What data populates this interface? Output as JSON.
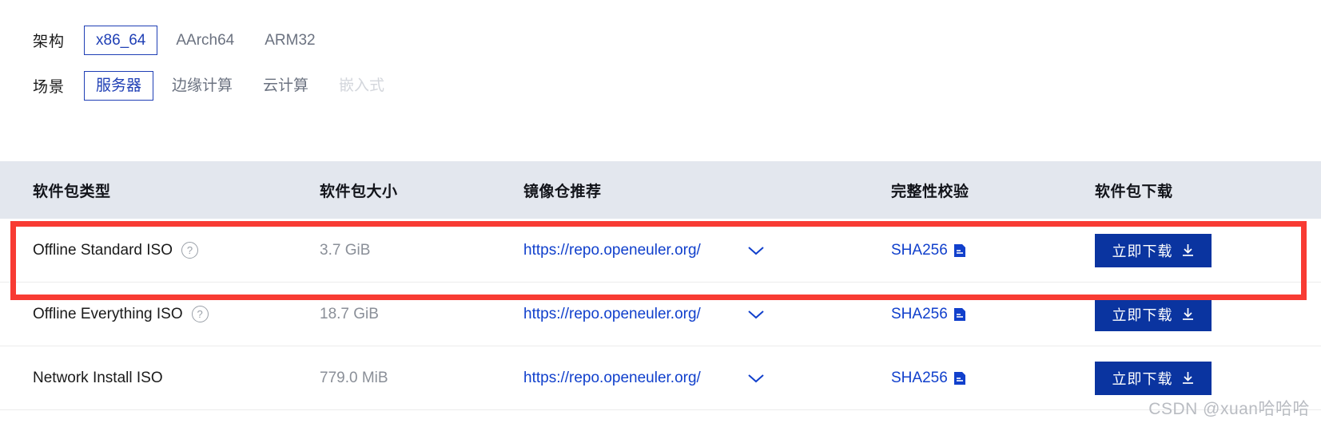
{
  "filters": [
    {
      "label": "架构",
      "name": "architecture",
      "options": [
        {
          "label": "x86_64",
          "state": "selected"
        },
        {
          "label": "AArch64",
          "state": "normal"
        },
        {
          "label": "ARM32",
          "state": "normal"
        }
      ]
    },
    {
      "label": "场景",
      "name": "scenario",
      "options": [
        {
          "label": "服务器",
          "state": "selected"
        },
        {
          "label": "边缘计算",
          "state": "normal"
        },
        {
          "label": "云计算",
          "state": "normal"
        },
        {
          "label": "嵌入式",
          "state": "disabled"
        }
      ]
    }
  ],
  "table": {
    "headers": {
      "type": "软件包类型",
      "size": "软件包大小",
      "repo": "镜像仓推荐",
      "checksum": "完整性校验",
      "download": "软件包下载"
    },
    "rows": [
      {
        "type": "Offline Standard ISO",
        "has_help": true,
        "size": "3.7 GiB",
        "repo": "https://repo.openeuler.org/",
        "checksum": "SHA256",
        "download": "立即下载",
        "highlighted": true
      },
      {
        "type": "Offline Everything ISO",
        "has_help": true,
        "size": "18.7 GiB",
        "repo": "https://repo.openeuler.org/",
        "checksum": "SHA256",
        "download": "立即下载",
        "highlighted": false
      },
      {
        "type": "Network Install ISO",
        "has_help": false,
        "size": "779.0 MiB",
        "repo": "https://repo.openeuler.org/",
        "checksum": "SHA256",
        "download": "立即下载",
        "highlighted": false
      }
    ]
  },
  "icons": {
    "help": "?",
    "chevron_down": "chevron-down-icon",
    "copy": "copy-icon",
    "download_arrow": "download-arrow-icon"
  },
  "watermark": "CSDN @xuan哈哈哈",
  "colors": {
    "accent_blue": "#1140cc",
    "button_blue": "#0a34a0",
    "header_bg": "#e3e7ee",
    "highlight_red": "#f83b33",
    "muted_text": "#8a8f98",
    "disabled_text": "#d3d6dc"
  }
}
